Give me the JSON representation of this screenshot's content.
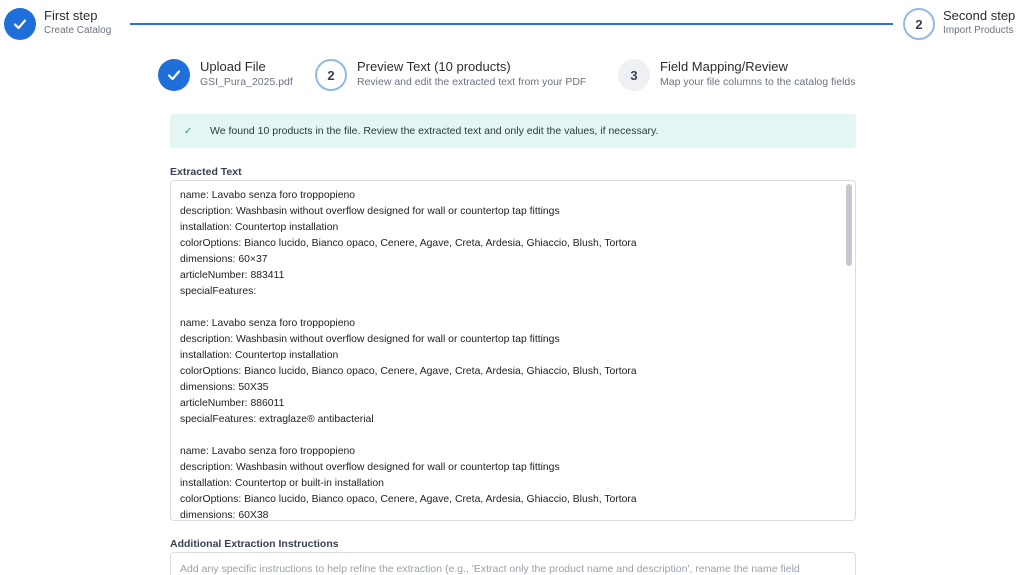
{
  "top_steps": [
    {
      "title": "First step",
      "subtitle": "Create Catalog",
      "state": "done"
    },
    {
      "number": "2",
      "title": "Second step",
      "subtitle": "Import Products",
      "state": "current"
    }
  ],
  "sub_steps": [
    {
      "title": "Upload File",
      "subtitle": "GSI_Pura_2025.pdf",
      "state": "done"
    },
    {
      "number": "2",
      "title": "Preview Text (10 products)",
      "subtitle": "Review and edit the extracted text from your PDF",
      "state": "current"
    },
    {
      "number": "3",
      "title": "Field Mapping/Review",
      "subtitle": "Map your file columns to the catalog fields",
      "state": "upcoming"
    }
  ],
  "alert": {
    "icon": "check-icon",
    "text": "We found 10 products in the file. Review the extracted text and only edit the values, if necessary."
  },
  "extracted": {
    "label": "Extracted Text",
    "products": [
      [
        "name: Lavabo senza foro troppopieno",
        "description: Washbasin without overflow designed for wall or countertop tap fittings",
        "installation: Countertop installation",
        "colorOptions: Bianco lucido, Bianco opaco, Cenere, Agave, Creta, Ardesia, Ghiaccio, Blush, Tortora",
        "dimensions: 60×37",
        "articleNumber: 883411",
        "specialFeatures:"
      ],
      [
        "name: Lavabo senza foro troppopieno",
        "description: Washbasin without overflow designed for wall or countertop tap fittings",
        "installation: Countertop installation",
        "colorOptions: Bianco lucido, Bianco opaco, Cenere, Agave, Creta, Ardesia, Ghiaccio, Blush, Tortora",
        "dimensions: 50X35",
        "articleNumber: 886011",
        "specialFeatures: extraglaze® antibacterial"
      ],
      [
        "name: Lavabo senza foro troppopieno",
        "description: Washbasin without overflow designed for wall or countertop tap fittings",
        "installation: Countertop or built-in installation",
        "colorOptions: Bianco lucido, Bianco opaco, Cenere, Agave, Creta, Ardesia, Ghiaccio, Blush, Tortora",
        "dimensions: 60X38"
      ]
    ]
  },
  "additional": {
    "label": "Additional Extraction Instructions",
    "placeholder": "Add any specific instructions to help refine the extraction (e.g., 'Extract only the product name and description', rename the name field"
  },
  "colors": {
    "accent": "#1e6fd9",
    "alert_bg": "#e4f6f4",
    "line": "#2f6fd0"
  }
}
